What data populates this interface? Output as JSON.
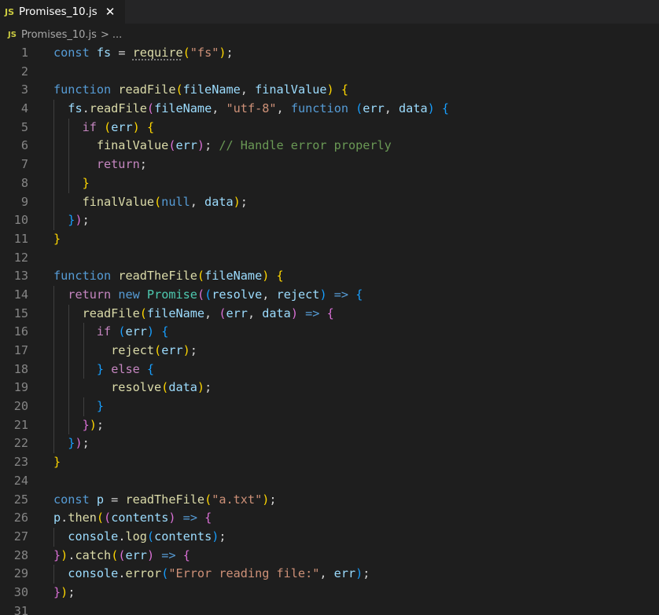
{
  "tab": {
    "badge": "JS",
    "label": "Promises_10.js",
    "close": "✕"
  },
  "breadcrumb": {
    "badge": "JS",
    "file": "Promises_10.js",
    "separator": ">",
    "more": "..."
  },
  "colors": {
    "keyword": "#569cd6",
    "control": "#c586c0",
    "variable": "#9cdcfe",
    "function": "#dcdcaa",
    "string": "#ce9178",
    "comment": "#6a9955",
    "class": "#4ec9b0",
    "bracket_1": "#ffd700",
    "bracket_2": "#da70d6",
    "bracket_3": "#179fff"
  },
  "code": {
    "lines": [
      {
        "n": "1",
        "tokens": [
          [
            "kw",
            "const"
          ],
          [
            "p",
            " "
          ],
          [
            "var",
            "fs"
          ],
          [
            "p",
            " = "
          ],
          [
            "fn hint",
            "require"
          ],
          [
            "b1",
            "("
          ],
          [
            "str",
            "\"fs\""
          ],
          [
            "b1",
            ")"
          ],
          [
            "p",
            ";"
          ]
        ]
      },
      {
        "n": "2",
        "tokens": []
      },
      {
        "n": "3",
        "tokens": [
          [
            "kw",
            "function"
          ],
          [
            "p",
            " "
          ],
          [
            "fn",
            "readFile"
          ],
          [
            "b1",
            "("
          ],
          [
            "var",
            "fileName"
          ],
          [
            "p",
            ", "
          ],
          [
            "var",
            "finalValue"
          ],
          [
            "b1",
            ")"
          ],
          [
            "p",
            " "
          ],
          [
            "b1",
            "{"
          ]
        ]
      },
      {
        "n": "4",
        "tokens": [
          [
            "p",
            "  "
          ],
          [
            "var",
            "fs"
          ],
          [
            "p",
            "."
          ],
          [
            "fn",
            "readFile"
          ],
          [
            "b2",
            "("
          ],
          [
            "var",
            "fileName"
          ],
          [
            "p",
            ", "
          ],
          [
            "str",
            "\"utf-8\""
          ],
          [
            "p",
            ", "
          ],
          [
            "kw",
            "function"
          ],
          [
            "p",
            " "
          ],
          [
            "b3",
            "("
          ],
          [
            "var",
            "err"
          ],
          [
            "p",
            ", "
          ],
          [
            "var",
            "data"
          ],
          [
            "b3",
            ")"
          ],
          [
            "p",
            " "
          ],
          [
            "b3",
            "{"
          ]
        ]
      },
      {
        "n": "5",
        "tokens": [
          [
            "p",
            "    "
          ],
          [
            "kw2",
            "if"
          ],
          [
            "p",
            " "
          ],
          [
            "b1",
            "("
          ],
          [
            "var",
            "err"
          ],
          [
            "b1",
            ")"
          ],
          [
            "p",
            " "
          ],
          [
            "b1",
            "{"
          ]
        ]
      },
      {
        "n": "6",
        "tokens": [
          [
            "p",
            "      "
          ],
          [
            "fn",
            "finalValue"
          ],
          [
            "b2",
            "("
          ],
          [
            "var",
            "err"
          ],
          [
            "b2",
            ")"
          ],
          [
            "p",
            "; "
          ],
          [
            "cm",
            "// Handle error properly"
          ]
        ]
      },
      {
        "n": "7",
        "tokens": [
          [
            "p",
            "      "
          ],
          [
            "kw2",
            "return"
          ],
          [
            "p",
            ";"
          ]
        ]
      },
      {
        "n": "8",
        "tokens": [
          [
            "p",
            "    "
          ],
          [
            "b1",
            "}"
          ]
        ]
      },
      {
        "n": "9",
        "tokens": [
          [
            "p",
            "    "
          ],
          [
            "fn",
            "finalValue"
          ],
          [
            "b1",
            "("
          ],
          [
            "kw",
            "null"
          ],
          [
            "p",
            ", "
          ],
          [
            "var",
            "data"
          ],
          [
            "b1",
            ")"
          ],
          [
            "p",
            ";"
          ]
        ]
      },
      {
        "n": "10",
        "tokens": [
          [
            "p",
            "  "
          ],
          [
            "b3",
            "}"
          ],
          [
            "b2",
            ")"
          ],
          [
            "p",
            ";"
          ]
        ]
      },
      {
        "n": "11",
        "tokens": [
          [
            "b1",
            "}"
          ]
        ]
      },
      {
        "n": "12",
        "tokens": []
      },
      {
        "n": "13",
        "tokens": [
          [
            "kw",
            "function"
          ],
          [
            "p",
            " "
          ],
          [
            "fn",
            "readTheFile"
          ],
          [
            "b1",
            "("
          ],
          [
            "var",
            "fileName"
          ],
          [
            "b1",
            ")"
          ],
          [
            "p",
            " "
          ],
          [
            "b1",
            "{"
          ]
        ]
      },
      {
        "n": "14",
        "tokens": [
          [
            "p",
            "  "
          ],
          [
            "kw2",
            "return"
          ],
          [
            "p",
            " "
          ],
          [
            "kw",
            "new"
          ],
          [
            "p",
            " "
          ],
          [
            "cls",
            "Promise"
          ],
          [
            "b2",
            "("
          ],
          [
            "b3",
            "("
          ],
          [
            "var",
            "resolve"
          ],
          [
            "p",
            ", "
          ],
          [
            "var",
            "reject"
          ],
          [
            "b3",
            ")"
          ],
          [
            "p",
            " "
          ],
          [
            "kw",
            "=>"
          ],
          [
            "p",
            " "
          ],
          [
            "b3",
            "{"
          ]
        ]
      },
      {
        "n": "15",
        "tokens": [
          [
            "p",
            "    "
          ],
          [
            "fn",
            "readFile"
          ],
          [
            "b1",
            "("
          ],
          [
            "var",
            "fileName"
          ],
          [
            "p",
            ", "
          ],
          [
            "b2",
            "("
          ],
          [
            "var",
            "err"
          ],
          [
            "p",
            ", "
          ],
          [
            "var",
            "data"
          ],
          [
            "b2",
            ")"
          ],
          [
            "p",
            " "
          ],
          [
            "kw",
            "=>"
          ],
          [
            "p",
            " "
          ],
          [
            "b2",
            "{"
          ]
        ]
      },
      {
        "n": "16",
        "tokens": [
          [
            "p",
            "      "
          ],
          [
            "kw2",
            "if"
          ],
          [
            "p",
            " "
          ],
          [
            "b3",
            "("
          ],
          [
            "var",
            "err"
          ],
          [
            "b3",
            ")"
          ],
          [
            "p",
            " "
          ],
          [
            "b3",
            "{"
          ]
        ]
      },
      {
        "n": "17",
        "tokens": [
          [
            "p",
            "        "
          ],
          [
            "fn",
            "reject"
          ],
          [
            "b1",
            "("
          ],
          [
            "var",
            "err"
          ],
          [
            "b1",
            ")"
          ],
          [
            "p",
            ";"
          ]
        ]
      },
      {
        "n": "18",
        "tokens": [
          [
            "p",
            "      "
          ],
          [
            "b3",
            "}"
          ],
          [
            "p",
            " "
          ],
          [
            "kw2",
            "else"
          ],
          [
            "p",
            " "
          ],
          [
            "b3",
            "{"
          ]
        ]
      },
      {
        "n": "19",
        "tokens": [
          [
            "p",
            "        "
          ],
          [
            "fn",
            "resolve"
          ],
          [
            "b1",
            "("
          ],
          [
            "var",
            "data"
          ],
          [
            "b1",
            ")"
          ],
          [
            "p",
            ";"
          ]
        ]
      },
      {
        "n": "20",
        "tokens": [
          [
            "p",
            "      "
          ],
          [
            "b3",
            "}"
          ]
        ]
      },
      {
        "n": "21",
        "tokens": [
          [
            "p",
            "    "
          ],
          [
            "b2",
            "}"
          ],
          [
            "b1",
            ")"
          ],
          [
            "p",
            ";"
          ]
        ]
      },
      {
        "n": "22",
        "tokens": [
          [
            "p",
            "  "
          ],
          [
            "b3",
            "}"
          ],
          [
            "b2",
            ")"
          ],
          [
            "p",
            ";"
          ]
        ]
      },
      {
        "n": "23",
        "tokens": [
          [
            "b1",
            "}"
          ]
        ]
      },
      {
        "n": "24",
        "tokens": []
      },
      {
        "n": "25",
        "tokens": [
          [
            "kw",
            "const"
          ],
          [
            "p",
            " "
          ],
          [
            "var",
            "p"
          ],
          [
            "p",
            " = "
          ],
          [
            "fn",
            "readTheFile"
          ],
          [
            "b1",
            "("
          ],
          [
            "str",
            "\"a.txt\""
          ],
          [
            "b1",
            ")"
          ],
          [
            "p",
            ";"
          ]
        ]
      },
      {
        "n": "26",
        "tokens": [
          [
            "var",
            "p"
          ],
          [
            "p",
            "."
          ],
          [
            "fn",
            "then"
          ],
          [
            "b1",
            "("
          ],
          [
            "b2",
            "("
          ],
          [
            "var",
            "contents"
          ],
          [
            "b2",
            ")"
          ],
          [
            "p",
            " "
          ],
          [
            "kw",
            "=>"
          ],
          [
            "p",
            " "
          ],
          [
            "b2",
            "{"
          ]
        ]
      },
      {
        "n": "27",
        "tokens": [
          [
            "p",
            "  "
          ],
          [
            "var",
            "console"
          ],
          [
            "p",
            "."
          ],
          [
            "fn",
            "log"
          ],
          [
            "b3",
            "("
          ],
          [
            "var",
            "contents"
          ],
          [
            "b3",
            ")"
          ],
          [
            "p",
            ";"
          ]
        ]
      },
      {
        "n": "28",
        "tokens": [
          [
            "b2",
            "}"
          ],
          [
            "b1",
            ")"
          ],
          [
            "p",
            "."
          ],
          [
            "fn",
            "catch"
          ],
          [
            "b1",
            "("
          ],
          [
            "b2",
            "("
          ],
          [
            "var",
            "err"
          ],
          [
            "b2",
            ")"
          ],
          [
            "p",
            " "
          ],
          [
            "kw",
            "=>"
          ],
          [
            "p",
            " "
          ],
          [
            "b2",
            "{"
          ]
        ]
      },
      {
        "n": "29",
        "tokens": [
          [
            "p",
            "  "
          ],
          [
            "var",
            "console"
          ],
          [
            "p",
            "."
          ],
          [
            "fn",
            "error"
          ],
          [
            "b3",
            "("
          ],
          [
            "str",
            "\"Error reading file:\""
          ],
          [
            "p",
            ", "
          ],
          [
            "var",
            "err"
          ],
          [
            "b3",
            ")"
          ],
          [
            "p",
            ";"
          ]
        ]
      },
      {
        "n": "30",
        "tokens": [
          [
            "b2",
            "}"
          ],
          [
            "b1",
            ")"
          ],
          [
            "p",
            ";"
          ]
        ]
      },
      {
        "n": "31",
        "tokens": []
      }
    ]
  }
}
